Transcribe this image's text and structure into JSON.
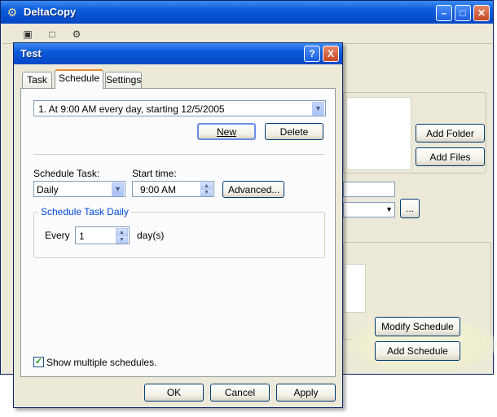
{
  "main_window": {
    "title": "DeltaCopy",
    "buttons": {
      "add_folder": "Add Folder",
      "add_files": "Add Files",
      "browse": "...",
      "modify_schedule": "Modify Schedule",
      "add_schedule": "Add Schedule"
    }
  },
  "dialog": {
    "title": "Test",
    "help": "?",
    "close": "X",
    "tabs": [
      "Task",
      "Schedule",
      "Settings"
    ],
    "active_tab": "Schedule",
    "schedule_select": "1. At 9:00 AM every day, starting 12/5/2005",
    "new_button": "New",
    "delete_button": "Delete",
    "schedule_task_label": "Schedule Task:",
    "schedule_task_value": "Daily",
    "start_time_label": "Start time:",
    "start_time_value": "9:00 AM",
    "advanced_button": "Advanced...",
    "group_title": "Schedule Task Daily",
    "every_label": "Every",
    "every_value": "1",
    "days_label": "day(s)",
    "show_multiple_label": "Show multiple schedules.",
    "show_multiple_checked": true,
    "ok_button": "OK",
    "cancel_button": "Cancel",
    "apply_button": "Apply"
  },
  "colors": {
    "titlebar": "#0a5bd9",
    "window_bg": "#ece9d8",
    "group_title": "#0046d5",
    "tab_highlight": "#e68b2c"
  }
}
